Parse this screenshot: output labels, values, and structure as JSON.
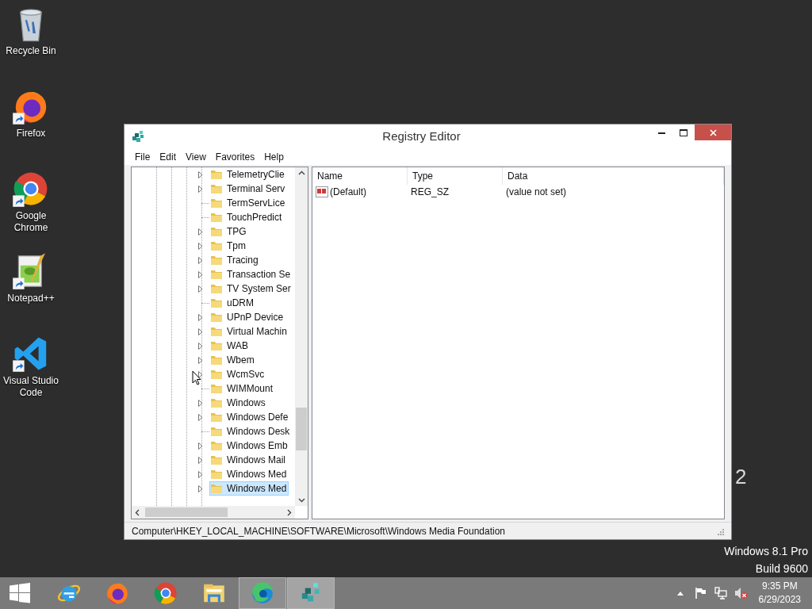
{
  "desktop_icons": [
    {
      "kind": "recycle",
      "label": "Recycle Bin",
      "shortcut": false
    },
    {
      "kind": "firefox",
      "label": "Firefox",
      "shortcut": true
    },
    {
      "kind": "chrome",
      "label": "Google Chrome",
      "shortcut": true
    },
    {
      "kind": "notepad",
      "label": "Notepad++",
      "shortcut": true
    },
    {
      "kind": "vscode",
      "label": "Visual Studio Code",
      "shortcut": true
    }
  ],
  "desktop_text": {
    "partial": "2",
    "edition": "Windows 8.1 Pro",
    "build": "Build 9600"
  },
  "window": {
    "title": "Registry Editor",
    "menu": [
      "File",
      "Edit",
      "View",
      "Favorites",
      "Help"
    ],
    "tree": [
      {
        "label": "TelemetryClie",
        "has_children": true,
        "selected": false
      },
      {
        "label": "Terminal Serv",
        "has_children": true,
        "selected": false
      },
      {
        "label": "TermServLice",
        "has_children": false,
        "selected": false
      },
      {
        "label": "TouchPredict",
        "has_children": false,
        "selected": false
      },
      {
        "label": "TPG",
        "has_children": true,
        "selected": false
      },
      {
        "label": "Tpm",
        "has_children": true,
        "selected": false
      },
      {
        "label": "Tracing",
        "has_children": true,
        "selected": false
      },
      {
        "label": "Transaction Se",
        "has_children": true,
        "selected": false
      },
      {
        "label": "TV System Ser",
        "has_children": true,
        "selected": false
      },
      {
        "label": "uDRM",
        "has_children": false,
        "selected": false
      },
      {
        "label": "UPnP Device",
        "has_children": true,
        "selected": false
      },
      {
        "label": "Virtual Machin",
        "has_children": true,
        "selected": false
      },
      {
        "label": "WAB",
        "has_children": true,
        "selected": false
      },
      {
        "label": "Wbem",
        "has_children": true,
        "selected": false
      },
      {
        "label": "WcmSvc",
        "has_children": true,
        "selected": false
      },
      {
        "label": "WIMMount",
        "has_children": false,
        "selected": false
      },
      {
        "label": "Windows",
        "has_children": true,
        "selected": false
      },
      {
        "label": "Windows Defe",
        "has_children": true,
        "selected": false
      },
      {
        "label": "Windows Desk",
        "has_children": false,
        "selected": false
      },
      {
        "label": "Windows Emb",
        "has_children": true,
        "selected": false
      },
      {
        "label": "Windows Mail",
        "has_children": true,
        "selected": false
      },
      {
        "label": "Windows Med",
        "has_children": true,
        "selected": false
      },
      {
        "label": "Windows Med",
        "has_children": true,
        "selected": true
      }
    ],
    "columns": [
      "Name",
      "Type",
      "Data"
    ],
    "rows": [
      [
        "(Default)",
        "REG_SZ",
        "(value not set)"
      ]
    ],
    "status_bar": "Computer\\HKEY_LOCAL_MACHINE\\SOFTWARE\\Microsoft\\Windows Media Foundation"
  },
  "taskbar": {
    "items": [
      {
        "kind": "ie",
        "running": false,
        "selected": false
      },
      {
        "kind": "firefox",
        "running": false,
        "selected": false
      },
      {
        "kind": "chrome",
        "running": false,
        "selected": false
      },
      {
        "kind": "explorer",
        "running": false,
        "selected": false
      },
      {
        "kind": "edge",
        "running": true,
        "selected": false
      },
      {
        "kind": "regedit",
        "running": true,
        "selected": true
      }
    ],
    "time": "9:35 PM",
    "date": "6/29/2023"
  }
}
